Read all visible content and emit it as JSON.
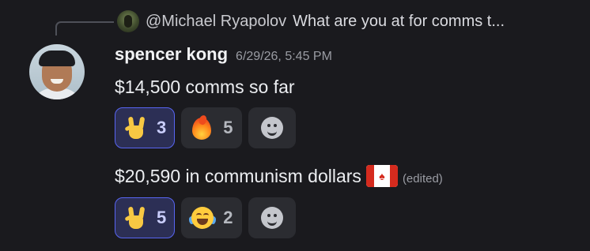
{
  "reply": {
    "author": "@Michael Ryapolov",
    "preview": "What are you at for comms t..."
  },
  "message": {
    "author": "spencer kong",
    "timestamp": "6/29/26, 5:45 PM",
    "lines": [
      {
        "text": "$14,500 comms so far",
        "reactions": [
          {
            "emoji": "sign-of-the-horns",
            "count": "3",
            "me": true
          },
          {
            "emoji": "fire",
            "count": "5",
            "me": false
          }
        ]
      },
      {
        "text": "$20,590 in communism dollars",
        "flag": "flag-canada",
        "edited": "(edited)",
        "reactions": [
          {
            "emoji": "sign-of-the-horns",
            "count": "5",
            "me": true
          },
          {
            "emoji": "face-with-tears-of-joy",
            "count": "2",
            "me": false
          }
        ]
      }
    ]
  },
  "colors": {
    "background": "#1a1a1e",
    "accent": "#5865f2",
    "reaction_bg": "#2b2c31",
    "reaction_me_bg": "#2c2f55"
  }
}
